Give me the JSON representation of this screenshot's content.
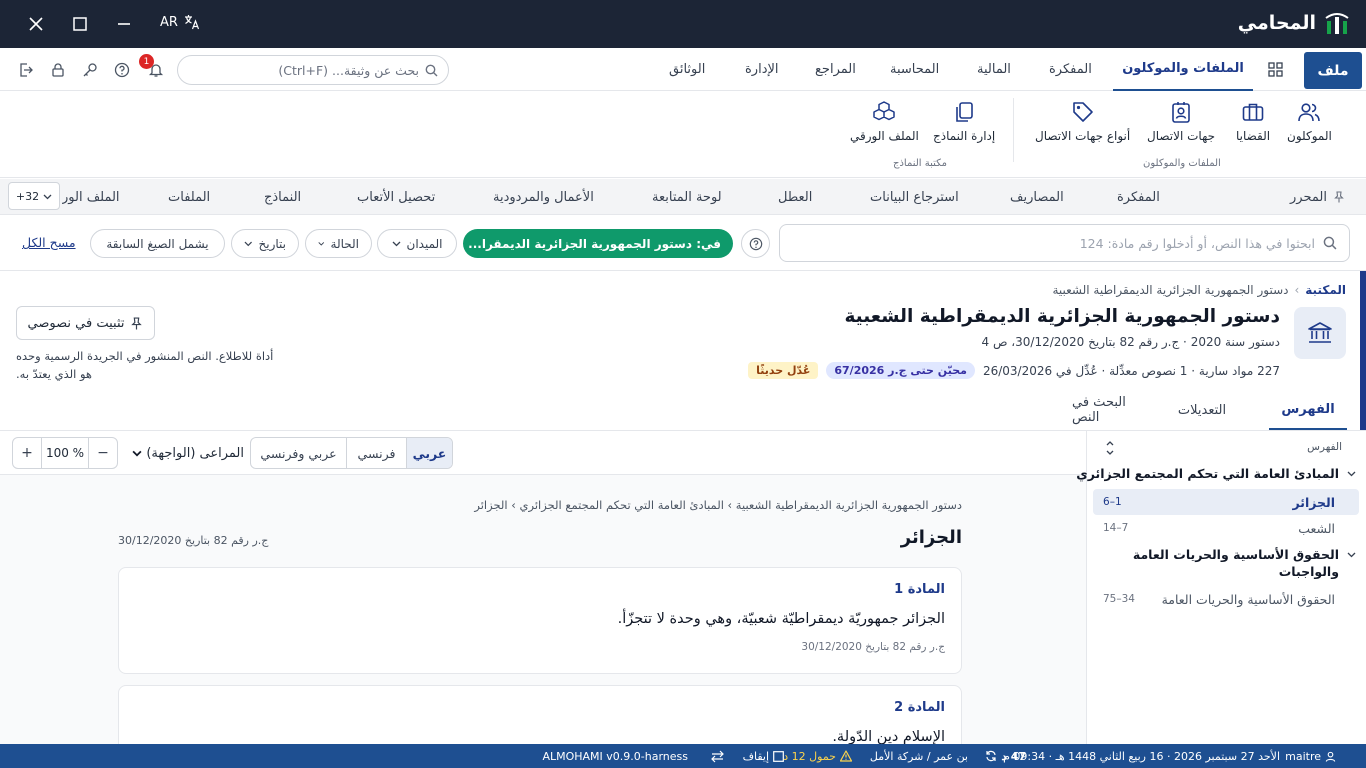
{
  "titlebar": {
    "app_name": "المحامي",
    "language": "AR"
  },
  "menubar": {
    "file": "ملف",
    "items": [
      "الملفات والموكلون",
      "المفكرة",
      "المالية",
      "المحاسبة",
      "المراجع",
      "الإدارة",
      "الوثائق"
    ],
    "search_placeholder": "بحث عن وثيقة... (Ctrl+F)",
    "notification_count": "1"
  },
  "ribbon": {
    "group1_label": "الملفات والموكلون",
    "group1": [
      "الموكلون",
      "القضايا",
      "جهات الاتصال",
      "أنواع جهات الاتصال"
    ],
    "group2_label": "مكتبة النماذج",
    "group2": [
      "إدارة النماذج",
      "الملف الورقي"
    ]
  },
  "tabs": {
    "items": [
      "المحرر",
      "المفكرة",
      "المصاريف",
      "استرجاع البيانات",
      "العطل",
      "لوحة المتابعة",
      "الأعمال والمردودية",
      "تحصيل الأتعاب",
      "النماذج",
      "الملفات",
      "الملف الور"
    ],
    "more": "+32"
  },
  "filters": {
    "search_placeholder": "ابحثوا في هذا النص، أو أدخلوا رقم مادة: 124",
    "active_chip": "في: دستور الجمهورية الجزائرية الديمقرا...",
    "field": "الميدان",
    "status": "الحالة",
    "date": "بتاريخ",
    "prior": "يشمل الصيغ السابقة",
    "clear": "مسح الكل"
  },
  "doc": {
    "breadcrumb_root": "المكتبة",
    "breadcrumb_current": "دستور الجمهورية الجزائرية الديمقراطية الشعبية",
    "title": "دستور الجمهورية الجزائرية الديمقراطية الشعبية",
    "meta": "دستور سنة 2020 · ج.ر رقم 82 بتاريخ 30/12/2020، ص 4",
    "stats": "227 مواد سارية · 1 نصوص معدِّلة · عُدِّل في 26/03/2026",
    "badge_updated": "محيّن حتى ج.ر 67/2026",
    "badge_recent": "عُدّل حديثًا",
    "pin": "تثبيت في نصوصي",
    "note": "أداة للاطلاع. النص المنشور في الجريدة الرسمية وحده هو الذي يعتدّ به."
  },
  "doc_tabs": [
    "الفهرس",
    "التعديلات",
    "البحث في النص"
  ],
  "viewer": {
    "langs": [
      "عربي",
      "فرنسي",
      "عربي وفرنسي"
    ],
    "mode": "المراعى (الواجهة)",
    "zoom": "100 %",
    "content_breadcrumb": "دستور الجمهورية الجزائرية الديمقراطية الشعبية › المبادئ العامة التي تحكم المجتمع الجزائري › الجزائر",
    "chapter_title": "الجزائر",
    "chapter_gazette": "ج.ر رقم 82 بتاريخ 30/12/2020",
    "articles": [
      {
        "num": "المادة 1",
        "text": "الجزائر جمهوريّة ديمقراطيّة شعبيّة، وهي وحدة لا تتجزّأ.",
        "ref": "ج.ر رقم 82 بتاريخ 30/12/2020"
      },
      {
        "num": "المادة 2",
        "text": "الإسلام دين الدّولة.",
        "ref": ""
      }
    ]
  },
  "toc": {
    "label": "الفهرس",
    "sections": [
      {
        "title": "المبادئ العامة التي تحكم المجتمع الجزائري",
        "items": [
          {
            "label": "الجزائر",
            "range": "1–6",
            "active": true
          },
          {
            "label": "الشعب",
            "range": "7–14"
          }
        ]
      },
      {
        "title_line1": "الحقوق الأساسية والحريات العامة",
        "title_line2": "والواجبات",
        "items": [
          {
            "label": "الحقوق الأساسية والحريات العامة",
            "range": "34–75"
          }
        ]
      }
    ]
  },
  "statusbar": {
    "user": "maitre",
    "date": "الأحد 27 سبتمبر 2026 · 16 ربيع الثاني 1448 هـ · 09:34 م",
    "count": "47 د",
    "firm": "بن عمر / شركة الأمل",
    "load": "حمول 12 د",
    "pause": "إيقاف",
    "version": "ALMOHAMI v0.9.0-harness"
  },
  "colors": {
    "primary": "#1e4f91",
    "titlebar": "#1c2536",
    "chip": "#0f9a6b"
  }
}
